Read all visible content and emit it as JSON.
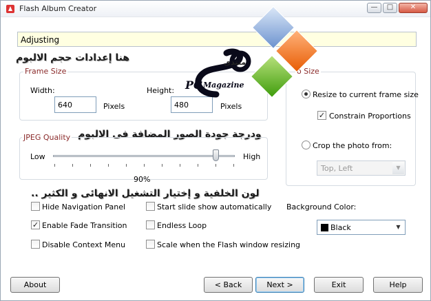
{
  "window": {
    "title": "Flash Album Creator",
    "controls": {
      "minimize": "—",
      "maximize": "□",
      "close": "✕"
    }
  },
  "header": {
    "section": "Adjusting"
  },
  "overlays": {
    "arabic_1": "هنا إعدادات حجم الالبوم",
    "arabic_2": "ودرجة جودة الصور المضافة فى الالبوم",
    "arabic_3": "لون الخلفية و إختيار التشغيل الانهائى و الكثير ..",
    "logo_top": "منتدى",
    "logo_main": "PC",
    "logo_sub": "Magazine"
  },
  "frame_size": {
    "label": "Frame Size",
    "width_label": "Width:",
    "width_value": "640",
    "height_label": "Height:",
    "height_value": "480",
    "unit": "Pixels"
  },
  "auto_size": {
    "label": "Auto Size",
    "visible_label": "o Size",
    "resize_label": "Resize to current frame size",
    "resize_selected": true,
    "constrain_label": "Constrain Proportions",
    "constrain_checked": true,
    "crop_label": "Crop the photo from:",
    "crop_selected": false,
    "crop_option": "Top, Left"
  },
  "jpeg_quality": {
    "label": "JPEG Quality",
    "low_label": "Low",
    "high_label": "High",
    "value_text": "90%",
    "value": 0.9
  },
  "options": {
    "hide_nav": {
      "label": "Hide Navigation Panel",
      "checked": false
    },
    "fade": {
      "label": "Enable Fade Transition",
      "checked": true
    },
    "disable_menu": {
      "label": "Disable Context Menu",
      "checked": false
    },
    "start_auto": {
      "label": "Start slide show automatically",
      "checked": false
    },
    "endless": {
      "label": "Endless Loop",
      "checked": false
    },
    "scale": {
      "label": "Scale when the Flash window resizing",
      "checked": false
    }
  },
  "background": {
    "label": "Background Color:",
    "value": "Black",
    "swatch_color": "#000000"
  },
  "buttons": {
    "about": "About",
    "back": "< Back",
    "next": "Next >",
    "exit": "Exit",
    "help": "Help"
  }
}
